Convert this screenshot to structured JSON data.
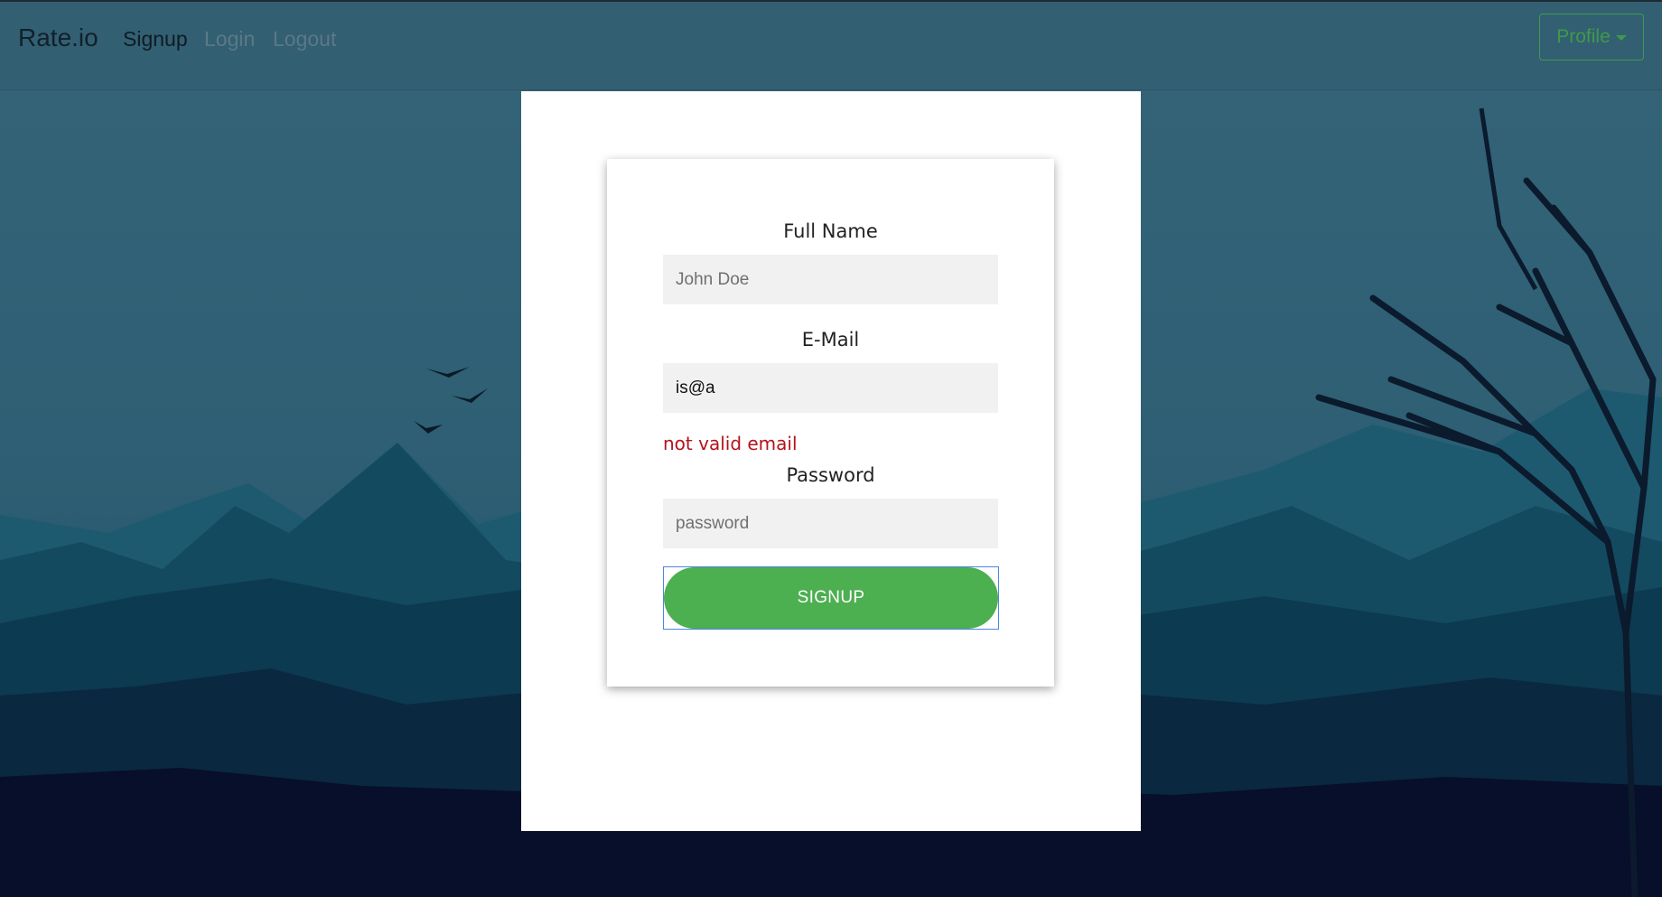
{
  "nav": {
    "brand": "Rate.io",
    "links": [
      {
        "label": "Signup",
        "active": true
      },
      {
        "label": "Login",
        "active": false
      },
      {
        "label": "Logout",
        "active": false
      }
    ],
    "profile_label": "Profile"
  },
  "form": {
    "fullname_label": "Full Name",
    "fullname_placeholder": "John Doe",
    "fullname_value": "",
    "email_label": "E-Mail",
    "email_value": "is@a",
    "email_error": "not valid email",
    "password_label": "Password",
    "password_placeholder": "password",
    "password_value": "",
    "submit_label": "SIGNUP"
  },
  "colors": {
    "accent_green": "#4caf50",
    "error_red": "#b5121b",
    "sky": "#2f5e72"
  }
}
